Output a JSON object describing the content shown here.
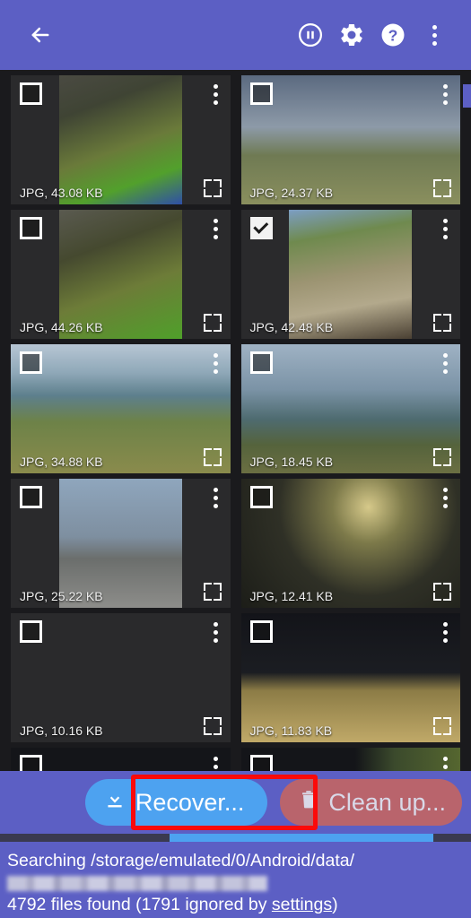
{
  "appbar": {
    "back_icon": "arrow-left-icon",
    "pause_icon": "pause-circle-icon",
    "settings_icon": "gear-icon",
    "help_icon": "help-circle-icon",
    "overflow_icon": "more-vertical-icon",
    "accent_color": "#5c5fc4"
  },
  "grid": {
    "items": [
      {
        "meta": "JPG, 43.08 KB",
        "checked": false,
        "menu_icon": "more-vertical-icon",
        "expand_icon": "fullscreen-icon"
      },
      {
        "meta": "JPG, 24.37 KB",
        "checked": false,
        "menu_icon": "more-vertical-icon",
        "expand_icon": "fullscreen-icon"
      },
      {
        "meta": "JPG, 44.26 KB",
        "checked": false,
        "menu_icon": "more-vertical-icon",
        "expand_icon": "fullscreen-icon"
      },
      {
        "meta": "JPG, 42.48 KB",
        "checked": true,
        "menu_icon": "more-vertical-icon",
        "expand_icon": "fullscreen-icon"
      },
      {
        "meta": "JPG, 34.88 KB",
        "checked": false,
        "menu_icon": "more-vertical-icon",
        "expand_icon": "fullscreen-icon"
      },
      {
        "meta": "JPG, 18.45 KB",
        "checked": false,
        "menu_icon": "more-vertical-icon",
        "expand_icon": "fullscreen-icon"
      },
      {
        "meta": "JPG, 25.22 KB",
        "checked": false,
        "menu_icon": "more-vertical-icon",
        "expand_icon": "fullscreen-icon"
      },
      {
        "meta": "JPG, 12.41 KB",
        "checked": false,
        "menu_icon": "more-vertical-icon",
        "expand_icon": "fullscreen-icon"
      },
      {
        "meta": "JPG, 10.16 KB",
        "checked": false,
        "menu_icon": "more-vertical-icon",
        "expand_icon": "fullscreen-icon"
      },
      {
        "meta": "JPG, 11.83 KB",
        "checked": false,
        "menu_icon": "more-vertical-icon",
        "expand_icon": "fullscreen-icon"
      }
    ]
  },
  "bottom": {
    "recover_label": "Recover...",
    "recover_icon": "download-icon",
    "recover_color": "#4da2f0",
    "clean_label": "Clean up...",
    "clean_icon": "trash-icon",
    "clean_color": "#b9646c",
    "highlight_color": "#fb0a0a",
    "progress_color": "#4da2f0",
    "status_line1": "Searching /storage/emulated/0/Android/data/",
    "status_line2_redacted": "",
    "status_line3_prefix": "4792 files found (1791 ignored by ",
    "status_link": "settings",
    "status_line3_suffix": ")"
  }
}
